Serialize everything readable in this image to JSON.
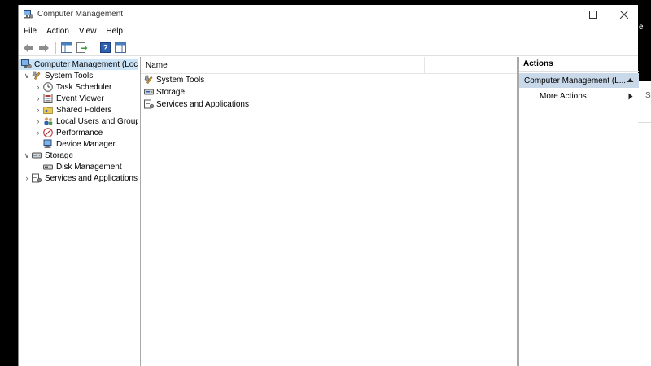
{
  "window": {
    "title": "Computer Management"
  },
  "menu": [
    {
      "label": "File"
    },
    {
      "label": "Action"
    },
    {
      "label": "View"
    },
    {
      "label": "Help"
    }
  ],
  "tree": {
    "root": "Computer Management (Local",
    "system_tools": "System Tools",
    "task_scheduler": "Task Scheduler",
    "event_viewer": "Event Viewer",
    "shared_folders": "Shared Folders",
    "local_users": "Local Users and Groups",
    "performance": "Performance",
    "device_manager": "Device Manager",
    "storage": "Storage",
    "disk_management": "Disk Management",
    "services": "Services and Applications"
  },
  "list": {
    "column_name": "Name",
    "items": [
      {
        "label": "System Tools"
      },
      {
        "label": "Storage"
      },
      {
        "label": "Services and Applications"
      }
    ]
  },
  "actions": {
    "header": "Actions",
    "group": "Computer Management (L...",
    "more": "More Actions"
  },
  "background": {
    "char_top": "e",
    "char_mid": "S"
  },
  "colors": {
    "selection": "#cce4f7",
    "actions_group": "#c9d9ea"
  }
}
